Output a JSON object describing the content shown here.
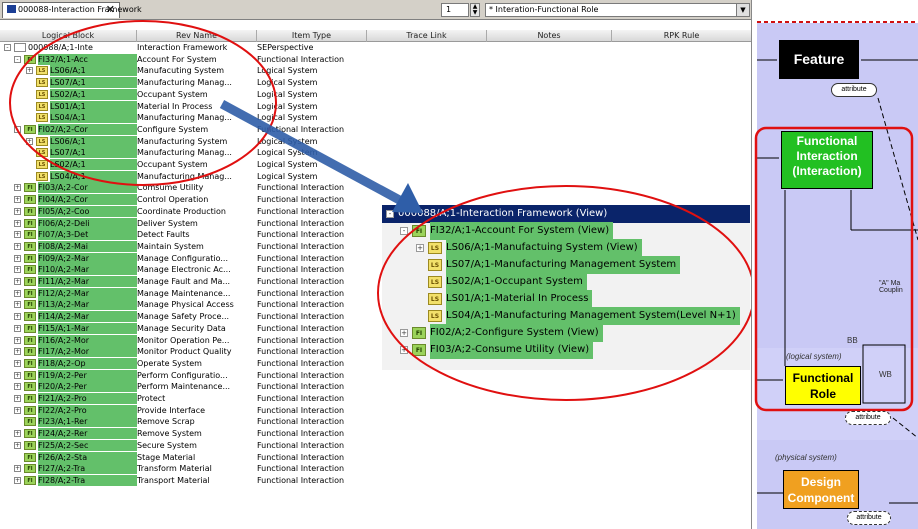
{
  "window": {
    "tab_label": "000088-Interaction Framework",
    "level_value": "1",
    "view_select": "* Interation-Functional Role"
  },
  "columns": [
    "Logical Block",
    "Rev Name",
    "Item Type",
    "Trace Link",
    "Notes",
    "RPK Rule"
  ],
  "tree": [
    {
      "block": "000088/A;1-Inte",
      "rev": "Interaction Framework",
      "type": "SEPerspective",
      "icon": "root",
      "exp": "-",
      "indent": 0
    },
    {
      "block": "FI32/A;1-Acc",
      "rev": "Account For System",
      "type": "Functional Interaction",
      "icon": "FI",
      "exp": "-",
      "indent": 1
    },
    {
      "block": "LS06/A;1",
      "rev": "Manufacuting System",
      "type": "Logical System",
      "icon": "LS",
      "exp": "+",
      "indent": 2
    },
    {
      "block": "LS07/A;1",
      "rev": "Manufacturing Manag...",
      "type": "Logical System",
      "icon": "LS",
      "exp": "",
      "indent": 2
    },
    {
      "block": "LS02/A;1",
      "rev": "Occupant System",
      "type": "Logical System",
      "icon": "LS",
      "exp": "",
      "indent": 2
    },
    {
      "block": "LS01/A;1",
      "rev": "Material In Process",
      "type": "Logical System",
      "icon": "LS",
      "exp": "",
      "indent": 2
    },
    {
      "block": "LS04/A;1",
      "rev": "Manufacturing Manag...",
      "type": "Logical System",
      "icon": "LS",
      "exp": "",
      "indent": 2
    },
    {
      "block": "FI02/A;2-Cor",
      "rev": "Configure System",
      "type": "Functional Interaction",
      "icon": "FI",
      "exp": "-",
      "indent": 1
    },
    {
      "block": "LS06/A;1",
      "rev": "Manufacturing System",
      "type": "Logical System",
      "icon": "LS",
      "exp": "+",
      "indent": 2
    },
    {
      "block": "LS07/A;1",
      "rev": "Manufacturing Manag...",
      "type": "Logical System",
      "icon": "LS",
      "exp": "",
      "indent": 2
    },
    {
      "block": "LS02/A;1",
      "rev": "Occupant System",
      "type": "Logical System",
      "icon": "LS",
      "exp": "",
      "indent": 2
    },
    {
      "block": "LS04/A;1",
      "rev": "Manufacturing Manag...",
      "type": "Logical System",
      "icon": "LS",
      "exp": "",
      "indent": 2
    },
    {
      "block": "FI03/A;2-Cor",
      "rev": "Comsume Utility",
      "type": "Functional Interaction",
      "icon": "FI",
      "exp": "+",
      "indent": 1
    },
    {
      "block": "FI04/A;2-Cor",
      "rev": "Control Operation",
      "type": "Functional Interaction",
      "icon": "FI",
      "exp": "+",
      "indent": 1
    },
    {
      "block": "FI05/A;2-Coo",
      "rev": "Coordinate Production",
      "type": "Functional Interaction",
      "icon": "FI",
      "exp": "+",
      "indent": 1
    },
    {
      "block": "FI06/A;2-Deli",
      "rev": "Deliver System",
      "type": "Functional Interaction",
      "icon": "FI",
      "exp": "+",
      "indent": 1
    },
    {
      "block": "FI07/A;3-Det",
      "rev": "Detect Faults",
      "type": "Functional Interaction",
      "icon": "FI",
      "exp": "+",
      "indent": 1
    },
    {
      "block": "FI08/A;2-Mai",
      "rev": "Maintain System",
      "type": "Functional Interaction",
      "icon": "FI",
      "exp": "+",
      "indent": 1
    },
    {
      "block": "FI09/A;2-Mar",
      "rev": "Manage Configuratio...",
      "type": "Functional Interaction",
      "icon": "FI",
      "exp": "+",
      "indent": 1
    },
    {
      "block": "FI10/A;2-Mar",
      "rev": "Manage Electronic Ac...",
      "type": "Functional Interaction",
      "icon": "FI",
      "exp": "+",
      "indent": 1
    },
    {
      "block": "FI11/A;2-Mar",
      "rev": "Manage Fault and Ma...",
      "type": "Functional Interaction",
      "icon": "FI",
      "exp": "+",
      "indent": 1
    },
    {
      "block": "FI12/A;2-Mar",
      "rev": "Manage Maintenance...",
      "type": "Functional Interaction",
      "icon": "FI",
      "exp": "+",
      "indent": 1
    },
    {
      "block": "FI13/A;2-Mar",
      "rev": "Manage Physical Access",
      "type": "Functional Interaction",
      "icon": "FI",
      "exp": "+",
      "indent": 1
    },
    {
      "block": "FI14/A;2-Mar",
      "rev": "Manage Safety Proce...",
      "type": "Functional Interaction",
      "icon": "FI",
      "exp": "+",
      "indent": 1
    },
    {
      "block": "FI15/A;1-Mar",
      "rev": "Manage Security Data",
      "type": "Functional Interaction",
      "icon": "FI",
      "exp": "+",
      "indent": 1
    },
    {
      "block": "FI16/A;2-Mor",
      "rev": "Monitor Operation Pe...",
      "type": "Functional Interaction",
      "icon": "FI",
      "exp": "+",
      "indent": 1
    },
    {
      "block": "FI17/A;2-Mor",
      "rev": "Monitor Product Quality",
      "type": "Functional Interaction",
      "icon": "FI",
      "exp": "+",
      "indent": 1
    },
    {
      "block": "FI18/A;2-Op",
      "rev": "Operate System",
      "type": "Functional Interaction",
      "icon": "FI",
      "exp": "+",
      "indent": 1
    },
    {
      "block": "FI19/A;2-Per",
      "rev": "Perform Configuratio...",
      "type": "Functional Interaction",
      "icon": "FI",
      "exp": "+",
      "indent": 1
    },
    {
      "block": "FI20/A;2-Per",
      "rev": "Perform Maintenance...",
      "type": "Functional Interaction",
      "icon": "FI",
      "exp": "+",
      "indent": 1
    },
    {
      "block": "FI21/A;2-Pro",
      "rev": "Protect",
      "type": "Functional Interaction",
      "icon": "FI",
      "exp": "+",
      "indent": 1
    },
    {
      "block": "FI22/A;2-Pro",
      "rev": "Provide Interface",
      "type": "Functional Interaction",
      "icon": "FI",
      "exp": "+",
      "indent": 1
    },
    {
      "block": "FI23/A;1-Rer",
      "rev": "Remove Scrap",
      "type": "Functional Interaction",
      "icon": "FI",
      "exp": "",
      "indent": 1
    },
    {
      "block": "FI24/A;2-Rer",
      "rev": "Remove System",
      "type": "Functional Interaction",
      "icon": "FI",
      "exp": "+",
      "indent": 1
    },
    {
      "block": "FI25/A;2-Sec",
      "rev": "Secure System",
      "type": "Functional Interaction",
      "icon": "FI",
      "exp": "+",
      "indent": 1
    },
    {
      "block": "FI26/A;2-Sta",
      "rev": "Stage Material",
      "type": "Functional Interaction",
      "icon": "FI",
      "exp": "",
      "indent": 1
    },
    {
      "block": "FI27/A;2-Tra",
      "rev": "Transform Material",
      "type": "Functional Interaction",
      "icon": "FI",
      "exp": "+",
      "indent": 1
    },
    {
      "block": "FI28/A;2-Tra",
      "rev": "Transport Material",
      "type": "Functional Interaction",
      "icon": "FI",
      "exp": "+",
      "indent": 1
    }
  ],
  "zoom": [
    {
      "text": "000088/A;1-Interaction Framework (View)",
      "icon": "",
      "exp": "-",
      "indent": 0,
      "style": "head"
    },
    {
      "text": "FI32/A;1-Account For System (View)",
      "icon": "FI",
      "exp": "-",
      "indent": 1,
      "style": "green"
    },
    {
      "text": "LS06/A;1-Manufactuing System (View)",
      "icon": "LS",
      "exp": "+",
      "indent": 2,
      "style": "green"
    },
    {
      "text": "LS07/A;1-Manufacturing Management System",
      "icon": "LS",
      "exp": "",
      "indent": 2,
      "style": "green"
    },
    {
      "text": "LS02/A;1-Occupant System",
      "icon": "LS",
      "exp": "",
      "indent": 2,
      "style": "green"
    },
    {
      "text": "LS01/A;1-Material In Process",
      "icon": "LS",
      "exp": "",
      "indent": 2,
      "style": "green"
    },
    {
      "text": "LS04/A;1-Manufacturing Management System(Level N+1)",
      "icon": "LS",
      "exp": "",
      "indent": 2,
      "style": "green"
    },
    {
      "text": "FI02/A;2-Configure System (View)",
      "icon": "FI",
      "exp": "+",
      "indent": 1,
      "style": "green"
    },
    {
      "text": "FI03/A;2-Consume Utility (View)",
      "icon": "FI",
      "exp": "+",
      "indent": 1,
      "style": "green"
    }
  ],
  "icon_labels": {
    "FI": "FI",
    "LS": "LS"
  },
  "diagram": {
    "feature": "Feature",
    "attribute_1": "attribute",
    "functional_interaction": "Functional Interaction (Interaction)",
    "note": "\"A\" Ma\nCouplin",
    "bb": "BB",
    "logical_system": "(logical system)",
    "functional_role": "Functional Role",
    "wb": "WB",
    "attribute_2": "attribute",
    "physical_system": "(physical system)",
    "design_component": "Design Component",
    "attribute_3": "attribute"
  },
  "colors": {
    "fi_highlight": "#63c06a",
    "selection": "#0a246a",
    "callout_red": "#e01010",
    "arrow_blue": "#2f5ea8",
    "lavender": "#c9c9f5",
    "feature_black": "#000000",
    "fi_green": "#22c022",
    "role_yellow": "#ffff00",
    "design_orange": "#f0a020"
  }
}
